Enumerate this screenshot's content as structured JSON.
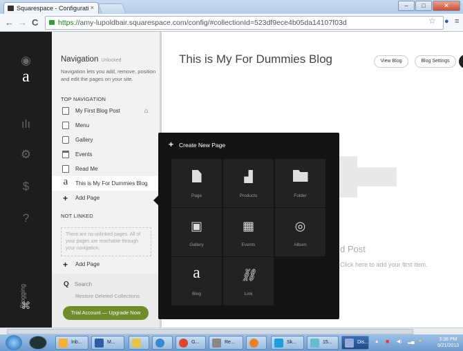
{
  "browser": {
    "tab_title": "Squarespace - Configurati",
    "tab_close": "×",
    "url_https": "https://",
    "url_rest": "amy-lupoldbair.squarespace.com/config/#collectionId=523df9ece4b05da14107f03d",
    "back": "←",
    "forward": "→",
    "reload": "C",
    "star": "☆"
  },
  "panel": {
    "title": "Navigation",
    "title_badge": "Unlocked",
    "description": "Navigation lets you add, remove, position and edit the pages on your site.",
    "top_nav_label": "TOP NAVIGATION",
    "items": [
      {
        "label": "My First Blog Post",
        "icon": "page-icon",
        "home": true
      },
      {
        "label": "Menu",
        "icon": "page-icon"
      },
      {
        "label": "Gallery",
        "icon": "gallery-icon"
      },
      {
        "label": "Events",
        "icon": "calendar-icon"
      },
      {
        "label": "Read Me",
        "icon": "page-icon"
      },
      {
        "label": "This is My For Dummies Blog",
        "icon": "blog-icon",
        "active": true
      }
    ],
    "add_page": "Add Page",
    "not_linked_label": "NOT LINKED",
    "unlinked_text": "There are no unlinked pages. All of your pages are reachable through your navigation.",
    "add_page_2": "Add Page",
    "search": "Search",
    "restore": "Restore Deleted Collections",
    "trial": "Trial Account — Upgrade Now"
  },
  "appbar": {
    "logo": "a",
    "blogging": "Blogging"
  },
  "main": {
    "title": "This is My For Dummies Blog",
    "view_blog": "View Blog",
    "blog_settings": "Blog Settings",
    "first_post": "d Post",
    "first_item": "Click here to add your first item."
  },
  "popup": {
    "title": "Create New Page",
    "tiles": [
      {
        "label": "Page",
        "icon": "page-icon"
      },
      {
        "label": "Products",
        "icon": "products-icon"
      },
      {
        "label": "Folder",
        "icon": "folder-icon"
      },
      {
        "label": "Gallery",
        "icon": "gallery-icon"
      },
      {
        "label": "Events",
        "icon": "calendar-icon"
      },
      {
        "label": "Album",
        "icon": "album-icon"
      },
      {
        "label": "Blog",
        "icon": "blog-icon",
        "glyph": "a"
      },
      {
        "label": "Link",
        "icon": "link-icon"
      }
    ]
  },
  "taskbar": {
    "items": [
      {
        "label": "Inb..."
      },
      {
        "label": "M..."
      },
      {
        "label": ""
      },
      {
        "label": ""
      },
      {
        "label": "G..."
      },
      {
        "label": "Re..."
      },
      {
        "label": ""
      },
      {
        "label": "Sk..."
      },
      {
        "label": "15..."
      },
      {
        "label": "Dis..."
      }
    ],
    "time": "3:38 PM",
    "date": "9/21/2013"
  }
}
